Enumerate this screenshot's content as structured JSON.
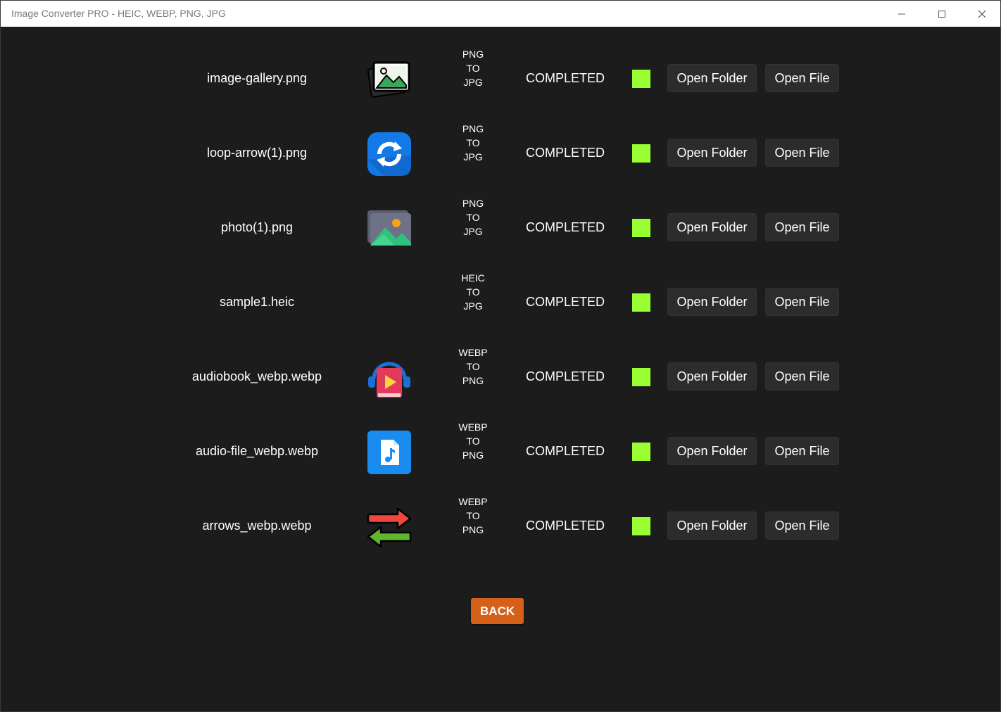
{
  "window": {
    "title": "Image Converter PRO - HEIC, WEBP, PNG, JPG",
    "minimize_symbol": "—",
    "maximize_symbol": "☐",
    "close_symbol": "✕"
  },
  "colors": {
    "status_indicator": "#99ff33",
    "back_button": "#d4601a",
    "background": "#1c1c1c",
    "button_bg": "#2c2c2c"
  },
  "files": [
    {
      "name": "image-gallery.png",
      "icon": "image-gallery-icon",
      "from": "PNG",
      "to_word": "TO",
      "target": "JPG",
      "status": "COMPLETED",
      "open_folder": "Open Folder",
      "open_file": "Open File"
    },
    {
      "name": "loop-arrow(1).png",
      "icon": "loop-arrow-icon",
      "from": "PNG",
      "to_word": "TO",
      "target": "JPG",
      "status": "COMPLETED",
      "open_folder": "Open Folder",
      "open_file": "Open File"
    },
    {
      "name": "photo(1).png",
      "icon": "photo-icon",
      "from": "PNG",
      "to_word": "TO",
      "target": "JPG",
      "status": "COMPLETED",
      "open_folder": "Open Folder",
      "open_file": "Open File"
    },
    {
      "name": "sample1.heic",
      "icon": "",
      "from": "HEIC",
      "to_word": "TO",
      "target": "JPG",
      "status": "COMPLETED",
      "open_folder": "Open Folder",
      "open_file": "Open File"
    },
    {
      "name": "audiobook_webp.webp",
      "icon": "audiobook-icon",
      "from": "WEBP",
      "to_word": "TO",
      "target": "PNG",
      "status": "COMPLETED",
      "open_folder": "Open Folder",
      "open_file": "Open File"
    },
    {
      "name": "audio-file_webp.webp",
      "icon": "audio-file-icon",
      "from": "WEBP",
      "to_word": "TO",
      "target": "PNG",
      "status": "COMPLETED",
      "open_folder": "Open Folder",
      "open_file": "Open File"
    },
    {
      "name": "arrows_webp.webp",
      "icon": "arrows-icon",
      "from": "WEBP",
      "to_word": "TO",
      "target": "PNG",
      "status": "COMPLETED",
      "open_folder": "Open Folder",
      "open_file": "Open File"
    }
  ],
  "back_label": "BACK"
}
